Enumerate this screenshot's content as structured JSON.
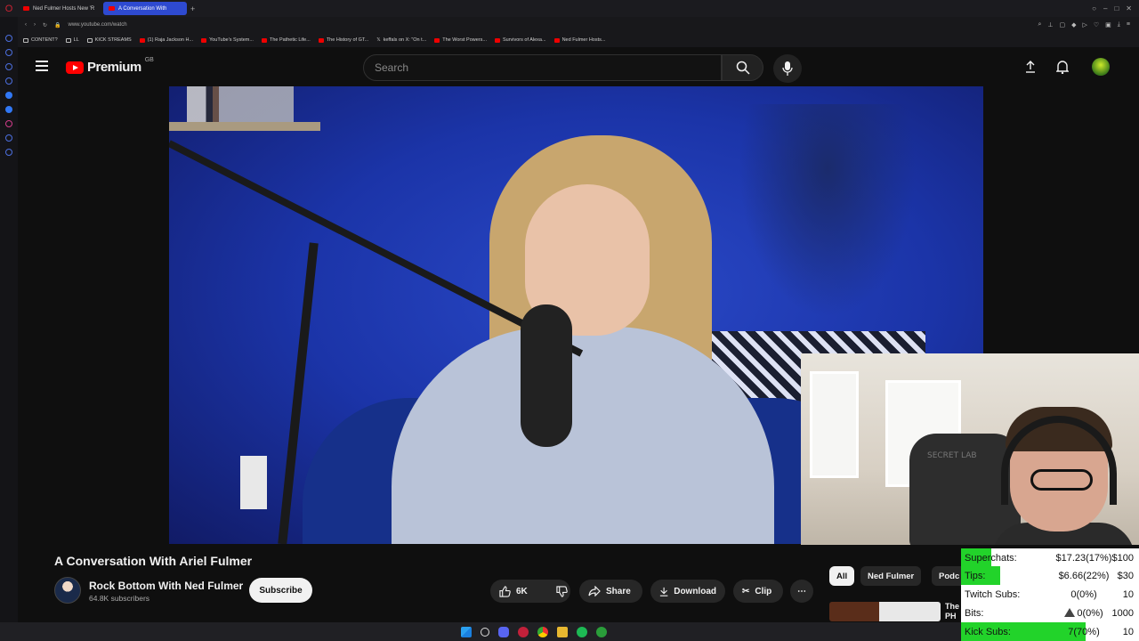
{
  "browser": {
    "tabs": [
      {
        "label": "Ned Fulmer Hosts New 'R",
        "active": false
      },
      {
        "label": "A Conversation With",
        "active": true
      }
    ],
    "url": "www.youtube.com/watch",
    "bookmarks": [
      {
        "label": "CONTENT?",
        "kind": "folder"
      },
      {
        "label": "LL",
        "kind": "folder"
      },
      {
        "label": "KICK STREAMS",
        "kind": "folder"
      },
      {
        "label": "(1) Raja Jackson H...",
        "kind": "yt"
      },
      {
        "label": "YouTube's System...",
        "kind": "yt"
      },
      {
        "label": "The Pathetic Life...",
        "kind": "yt"
      },
      {
        "label": "The History of GT...",
        "kind": "yt"
      },
      {
        "label": "keffals on X: \"On t...",
        "kind": "x"
      },
      {
        "label": "The Worst Powers...",
        "kind": "yt"
      },
      {
        "label": "Survivors of Alexa...",
        "kind": "yt"
      },
      {
        "label": "Ned Fulmer Hosts...",
        "kind": "yt"
      }
    ]
  },
  "youtube": {
    "logo_text": "Premium",
    "region": "GB",
    "search_placeholder": "Search"
  },
  "video": {
    "title": "A Conversation With Ariel Fulmer",
    "channel": "Rock Bottom With Ned Fulmer",
    "subscribers": "64.8K subscribers",
    "subscribe_label": "Subscribe",
    "likes": "6K",
    "share_label": "Share",
    "download_label": "Download",
    "clip_label": "Clip"
  },
  "chips": [
    "All",
    "Ned Fulmer",
    "Podc"
  ],
  "recommendation": {
    "title_fragment": "The",
    "title_fragment2": "PH"
  },
  "webcam": {
    "chair_text": "SECRET LAB"
  },
  "stats": {
    "rows": [
      {
        "label": "Superchats:",
        "value": "$17.23(17%)",
        "target": "$100",
        "fill": 0.17
      },
      {
        "label": "Tips:",
        "value": "$6.66(22%)",
        "target": "$30",
        "fill": 0.22
      },
      {
        "label": "Twitch Subs:",
        "value": "0(0%)",
        "target": "10",
        "fill": 0
      },
      {
        "label": "Bits:",
        "value": "0(0%)",
        "target": "1000",
        "fill": 0
      },
      {
        "label": "Kick Subs:",
        "value": "7(70%)",
        "target": "10",
        "fill": 0.7
      }
    ]
  },
  "colors": {
    "yt_red": "#ff0000",
    "stats_bar": "#22d32a",
    "active_tab": "#2e4ad0"
  }
}
